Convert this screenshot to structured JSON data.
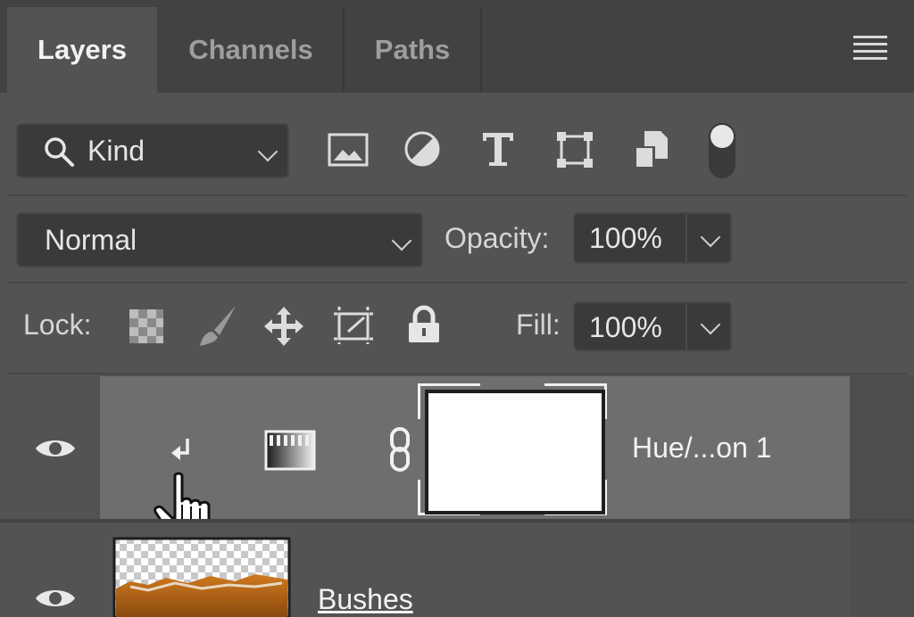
{
  "tabs": [
    {
      "label": "Layers",
      "active": true
    },
    {
      "label": "Channels",
      "active": false
    },
    {
      "label": "Paths",
      "active": false
    }
  ],
  "filter": {
    "kind_label": "Kind",
    "icons": [
      "image-filter-icon",
      "adjustment-filter-icon",
      "type-filter-icon",
      "shape-filter-icon",
      "smart-object-filter-icon",
      "filter-toggle-icon"
    ]
  },
  "blend": {
    "mode": "Normal",
    "opacity_label": "Opacity:",
    "opacity_value": "100%"
  },
  "lock": {
    "label": "Lock:",
    "fill_label": "Fill:",
    "fill_value": "100%"
  },
  "layers": [
    {
      "name": "Hue/...on 1",
      "type": "adjustment",
      "selected": true
    },
    {
      "name": "Bushes",
      "type": "pixel",
      "selected": false
    }
  ],
  "colors": {
    "panel_bg": "#535353",
    "selected_row": "#6e6e6e",
    "field_bg": "#3a3a3a"
  }
}
